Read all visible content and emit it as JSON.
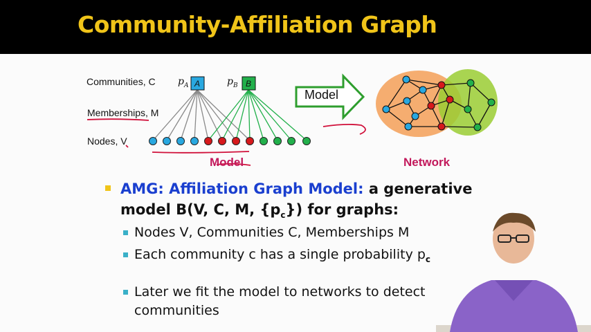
{
  "slide": {
    "title": "Community-Affiliation Graph",
    "labels": {
      "communities": "Communities, C",
      "memberships": "Memberships, M",
      "nodes": "Nodes, V",
      "pA": "p",
      "pA_sub": "A",
      "pB": "p",
      "pB_sub": "B",
      "boxA": "A",
      "boxB": "B"
    },
    "arrow_label": "Model",
    "caption_model": "Model",
    "caption_network": "Network",
    "bullet": {
      "bold_prefix": "AMG: Affiliation Graph Model:",
      "rest": " a generative",
      "line2": "model B(V, C, M, {p",
      "line2_sub": "c",
      "line2_end": "}) for graphs:"
    },
    "sub_bullets": [
      {
        "text": "Nodes V, Communities C, Memberships M"
      },
      {
        "text": "Each community c has a single probability p",
        "sub": "c"
      },
      {
        "text": "Later we fit the model to networks to detect"
      },
      {
        "text": "communities"
      }
    ],
    "colors": {
      "title": "#f0c419",
      "community_a": "#29a8e0",
      "community_b": "#22b04b",
      "overlap": "#d7191c",
      "network_a": "#f4a460",
      "network_b": "#9acd32"
    }
  }
}
